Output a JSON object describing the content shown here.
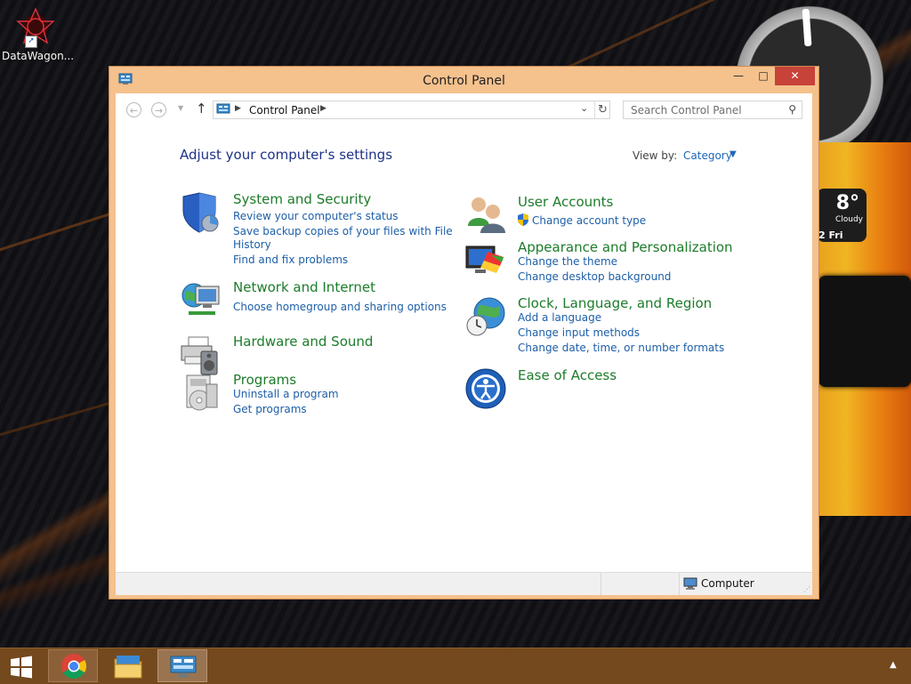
{
  "desktop": {
    "icons": [
      {
        "label": "DataWagon..."
      }
    ],
    "weather": {
      "temp": "8°",
      "condition": "Cloudy",
      "date": "2 Fri"
    }
  },
  "window": {
    "title": "Control Panel",
    "minimize_glyph": "—",
    "maximize_glyph": "□",
    "close_glyph": "✕",
    "address": {
      "crumb": "Control Panel"
    },
    "search": {
      "placeholder": "Search Control Panel"
    },
    "heading": "Adjust your computer's settings",
    "view_by": {
      "label": "View by:",
      "value": "Category"
    },
    "categories_left": [
      {
        "title": "System and Security",
        "icon": "shield-icon",
        "links": [
          "Review your computer's status",
          "Save backup copies of your files with File",
          "History",
          "Find and fix problems"
        ]
      },
      {
        "title": "Network and Internet",
        "icon": "network-globe-icon",
        "links": [
          "Choose homegroup and sharing options"
        ]
      },
      {
        "title": "Hardware and Sound",
        "icon": "printer-speaker-icon",
        "links": []
      },
      {
        "title": "Programs",
        "icon": "programs-box-icon",
        "links": [
          "Uninstall a program",
          "Get programs"
        ]
      }
    ],
    "categories_right": [
      {
        "title": "User Accounts",
        "icon": "users-icon",
        "links": [
          "Change account type"
        ]
      },
      {
        "title": "Appearance and Personalization",
        "icon": "monitor-palette-icon",
        "links": [
          "Change the theme",
          "Change desktop background"
        ]
      },
      {
        "title": "Clock, Language, and Region",
        "icon": "globe-clock-icon",
        "links": [
          "Add a language",
          "Change input methods",
          "Change date, time, or number formats"
        ]
      },
      {
        "title": "Ease of Access",
        "icon": "ease-of-access-icon",
        "links": []
      }
    ],
    "status": {
      "location": "Computer"
    }
  },
  "taskbar": {
    "items": [
      {
        "name": "Chrome",
        "icon": "chrome-icon"
      },
      {
        "name": "File Explorer",
        "icon": "folder-icon"
      },
      {
        "name": "Control Panel",
        "icon": "control-panel-icon"
      }
    ]
  },
  "colors": {
    "window_frame": "#f5c18d",
    "close_button": "#c7433a",
    "category_title": "#1c7c2a",
    "link": "#1d5fa8",
    "heading": "#1e3287",
    "taskbar": "#74491e"
  }
}
